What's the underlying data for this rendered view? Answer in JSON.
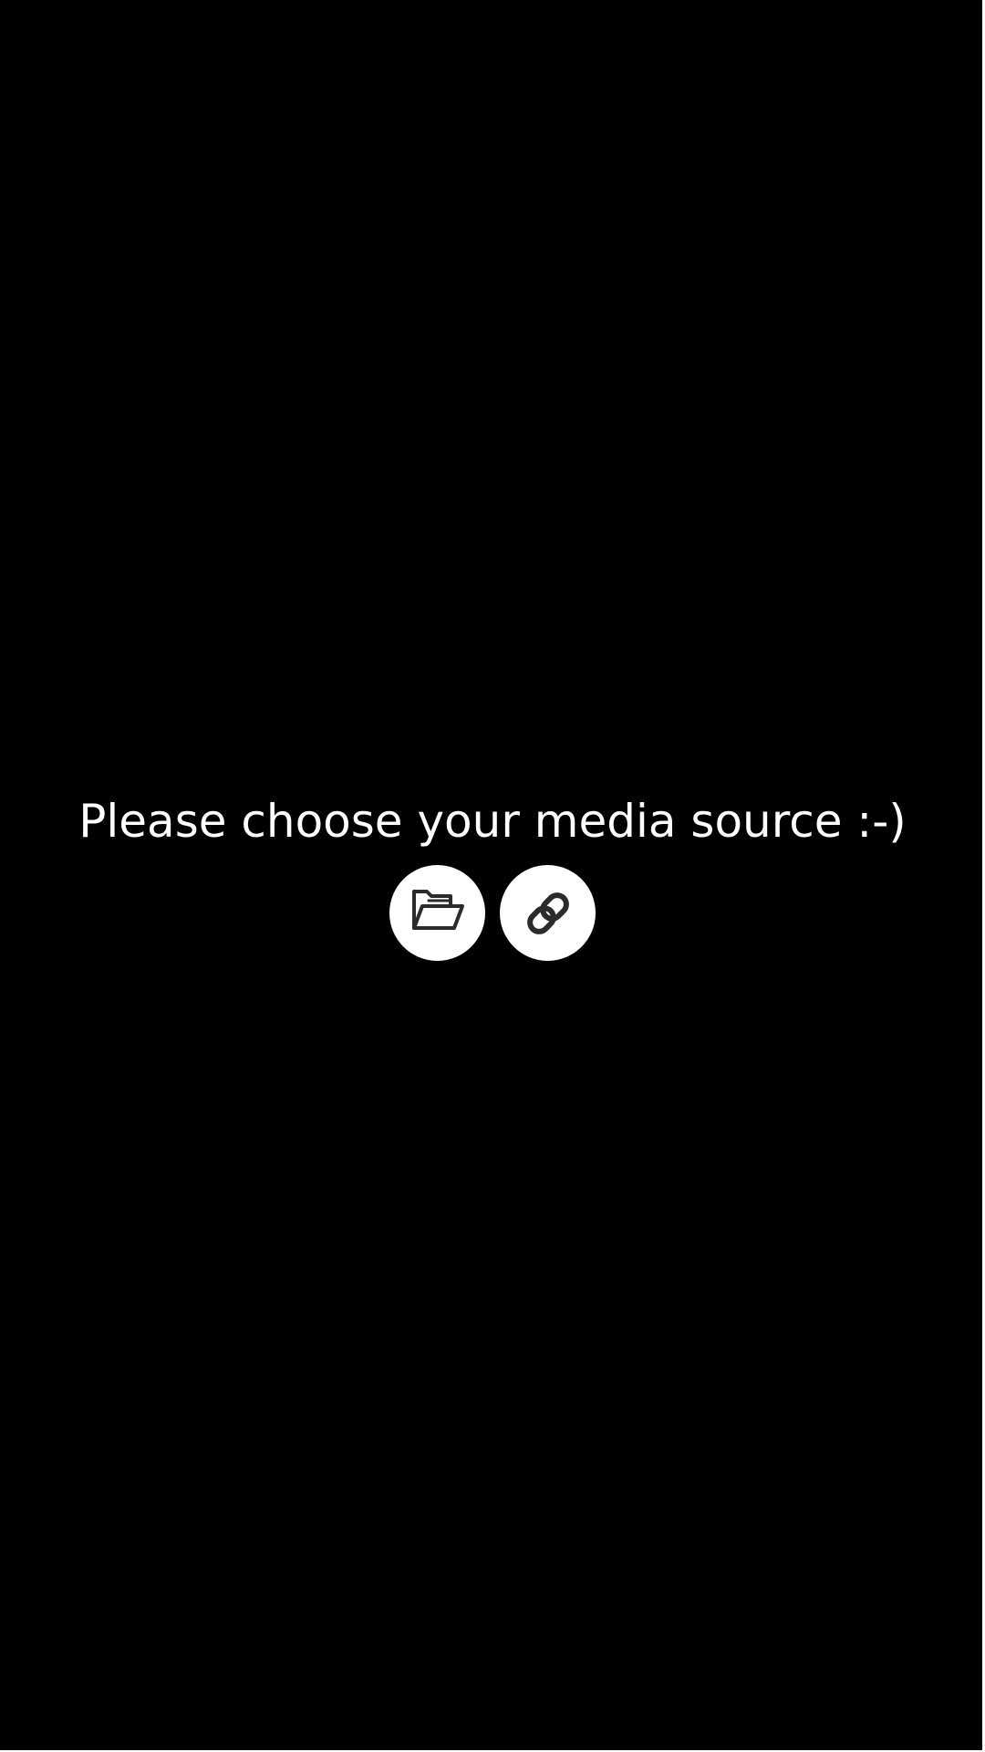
{
  "colors": {
    "background": "#000000",
    "text": "#ffffff",
    "button_fill": "#ffffff",
    "icon": "#2b2b2b"
  },
  "prompt": {
    "text": "Please choose your media source :-)"
  },
  "buttons": [
    {
      "name": "open-file-button",
      "icon": "folder-open-icon"
    },
    {
      "name": "open-url-button",
      "icon": "link-icon"
    }
  ]
}
